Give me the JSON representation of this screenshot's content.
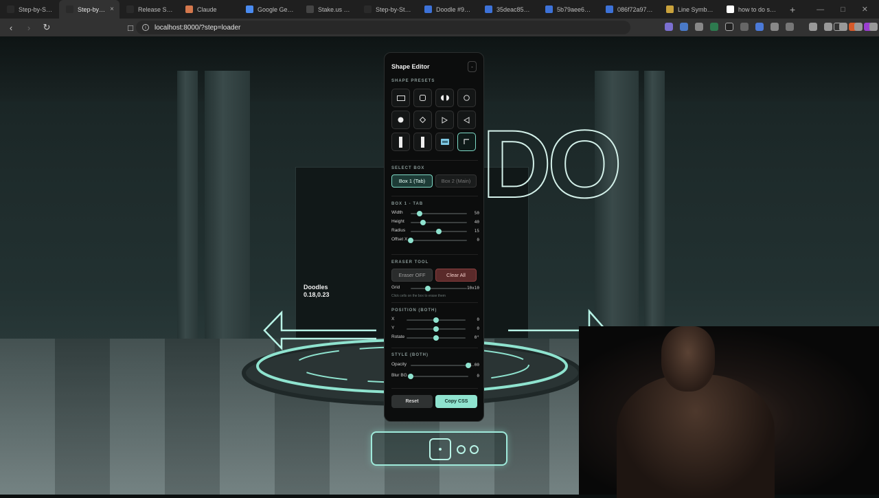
{
  "browser": {
    "tabs": [
      {
        "title": "Step-by-Step D",
        "icon": "x-logo-icon",
        "active": false
      },
      {
        "title": "Step-by-St",
        "icon": "x-logo-icon",
        "active": true
      },
      {
        "title": "Release Super",
        "icon": "github-icon",
        "active": false
      },
      {
        "title": "Claude",
        "icon": "claude-icon",
        "active": false
      },
      {
        "title": "Google Gemini",
        "icon": "gemini-icon",
        "active": false
      },
      {
        "title": "Stake.us - The",
        "icon": "stake-icon",
        "active": false
      },
      {
        "title": "Step-by-Step D",
        "icon": "x-logo-icon",
        "active": false
      },
      {
        "title": "Doodle #9140",
        "icon": "doodle-icon",
        "active": false
      },
      {
        "title": "35deac855c99",
        "icon": "doodle-icon",
        "active": false
      },
      {
        "title": "5b79aee6a632",
        "icon": "doodle-icon",
        "active": false
      },
      {
        "title": "086f72a97b3a",
        "icon": "doodle-icon",
        "active": false
      },
      {
        "title": "Line Symbols C",
        "icon": "globe-icon",
        "active": false
      },
      {
        "title": "how to do stac",
        "icon": "google-icon",
        "active": false
      }
    ],
    "url": "localhost:8000/?step=loader"
  },
  "scene": {
    "big_text": "DO",
    "doodles_label": "Doodles",
    "doodles_coords": "0.18,0.23"
  },
  "editor": {
    "title": "Shape Editor",
    "collapse_label": "-",
    "presets_label": "SHAPE PRESETS",
    "select_box_label": "SELECT BOX",
    "box1_label": "Box 1 (Tab)",
    "box2_label": "Box 2 (Main)",
    "box1_section_label": "BOX 1 - TAB",
    "box1_sliders": [
      {
        "label": "Width",
        "value": "50",
        "fraction": 0.16
      },
      {
        "label": "Height",
        "value": "40",
        "fraction": 0.22
      },
      {
        "label": "Radius",
        "value": "15",
        "fraction": 0.5
      },
      {
        "label": "Offset X",
        "value": "0",
        "fraction": 0.0
      }
    ],
    "eraser_section_label": "ERASER TOOL",
    "eraser_label": "Eraser OFF",
    "clear_label": "Clear All",
    "grid_slider": {
      "label": "Grid",
      "value": "10x10",
      "fraction": 0.3
    },
    "eraser_hint": "Click cells on the box to erase them",
    "position_section_label": "POSITION (BOTH)",
    "position_sliders": [
      {
        "label": "X",
        "value": "0",
        "fraction": 0.5
      },
      {
        "label": "Y",
        "value": "0",
        "fraction": 0.5
      },
      {
        "label": "Rotate",
        "value": "0°",
        "fraction": 0.5
      }
    ],
    "style_section_label": "STYLE (BOTH)",
    "style_sliders": [
      {
        "label": "Opacity",
        "value": "1.00",
        "fraction": 1.0
      },
      {
        "label": "Blur BG",
        "value": "0",
        "fraction": 0.0
      }
    ],
    "reset_label": "Reset",
    "copy_label": "Copy CSS"
  },
  "colors": {
    "accent": "#8fe3cf",
    "danger": "#8a3e3e"
  }
}
